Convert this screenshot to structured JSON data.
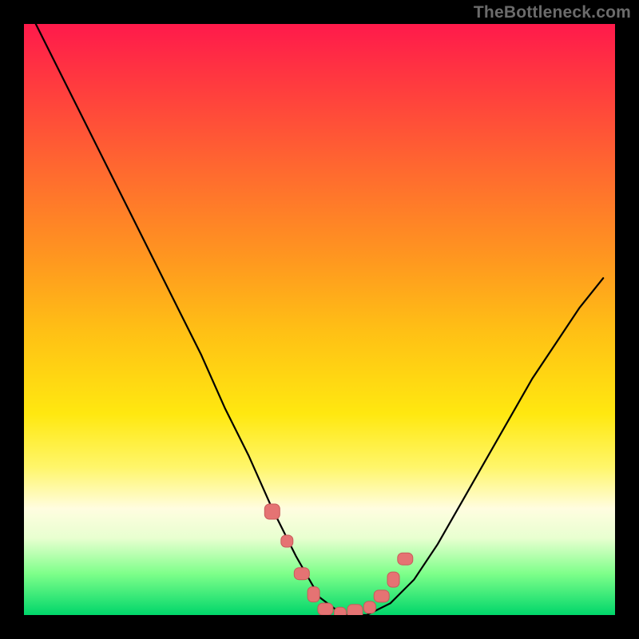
{
  "watermark": {
    "text": "TheBottleneck.com"
  },
  "chart_data": {
    "type": "line",
    "title": "",
    "xlabel": "",
    "ylabel": "",
    "xlim": [
      0,
      100
    ],
    "ylim": [
      0,
      100
    ],
    "grid": false,
    "legend": false,
    "series": [
      {
        "name": "bottleneck-curve",
        "x": [
          2,
          6,
          10,
          14,
          18,
          22,
          26,
          30,
          34,
          38,
          42,
          46,
          50,
          54,
          58,
          62,
          66,
          70,
          74,
          78,
          82,
          86,
          90,
          94,
          98
        ],
        "values": [
          100,
          92,
          84,
          76,
          68,
          60,
          52,
          44,
          35,
          27,
          18,
          10,
          3,
          0,
          0,
          2,
          6,
          12,
          19,
          26,
          33,
          40,
          46,
          52,
          57
        ]
      }
    ],
    "markers": {
      "name": "highlight-points",
      "x": [
        42,
        44.5,
        47,
        49,
        51,
        53.5,
        56,
        58.5,
        60.5,
        62.5,
        64.5
      ],
      "values": [
        17.5,
        12.5,
        7,
        3.5,
        1,
        0.3,
        0.5,
        1.3,
        3.2,
        6,
        9.5
      ],
      "color": "#e57373"
    },
    "background_gradient": {
      "top": "#ff1a4b",
      "mid": "#ffe810",
      "bottom": "#00d66a"
    }
  }
}
